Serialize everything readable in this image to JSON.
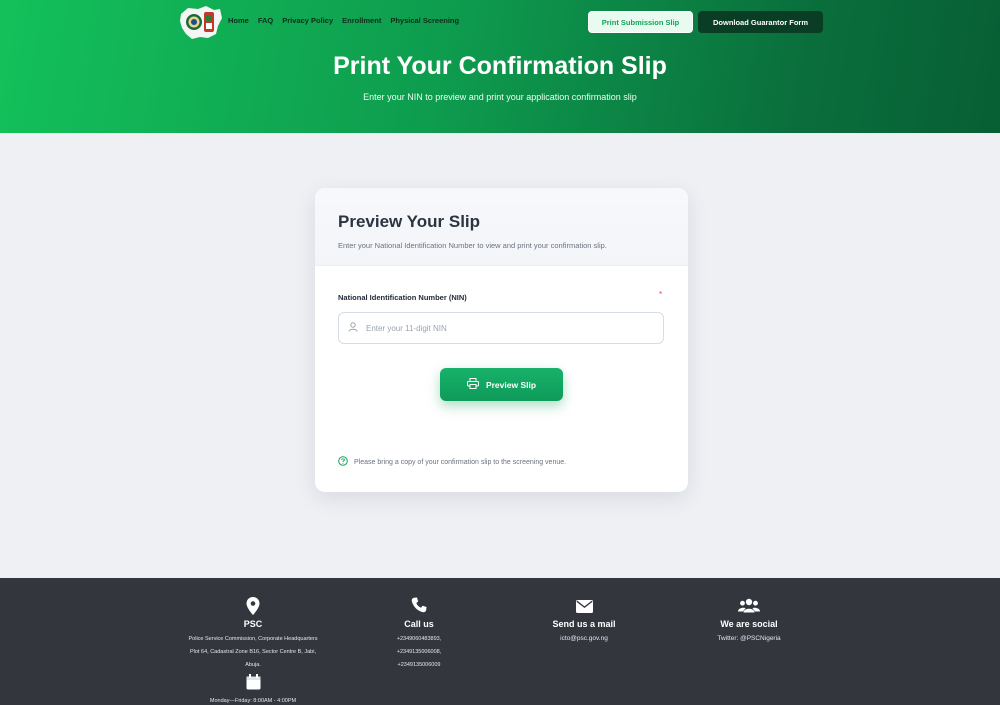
{
  "nav": {
    "links": [
      "Home",
      "FAQ",
      "Privacy Policy",
      "Enrollment",
      "Physical Screening"
    ],
    "print_button": "Print Submission Slip",
    "guarantor_button": "Download Guarantor Form"
  },
  "hero": {
    "title": "Print Your Confirmation Slip",
    "subtitle": "Enter your NIN to preview and print your application confirmation slip"
  },
  "card": {
    "title": "Preview Your Slip",
    "description": "Enter your National Identification Number to view and print your confirmation slip.",
    "field_label": "National Identification Number (NIN)",
    "required_mark": "*",
    "input_placeholder": "Enter your 11-digit NIN",
    "input_value": "",
    "button_label": "Preview Slip",
    "note": "Please bring a copy of your confirmation slip to the screening venue."
  },
  "footer": {
    "address": {
      "icon": "map-pin-icon",
      "title": "PSC",
      "lines": [
        "Police Service Commission, Corporate Headquarters",
        "Plot 64, Cadastral Zone B16, Sector Centre B, Jabi,",
        "Abuja."
      ],
      "hours_icon": "calendar-icon",
      "hours": "Monday—Friday: 8:00AM - 4:00PM"
    },
    "call": {
      "icon": "phone-icon",
      "title": "Call us",
      "lines": [
        "+2349060483893,",
        "+2349135006008,",
        "+2349135006009"
      ]
    },
    "mail": {
      "icon": "envelope-icon",
      "title": "Send us a mail",
      "email": "icto@psc.gov.ng"
    },
    "social": {
      "icon": "users-icon",
      "title": "We are social",
      "twitter": "Twitter: @PSCNigeria"
    }
  },
  "colors": {
    "brand_green": "#10a556",
    "dark_green": "#093d24",
    "footer_bg": "#33363d"
  }
}
